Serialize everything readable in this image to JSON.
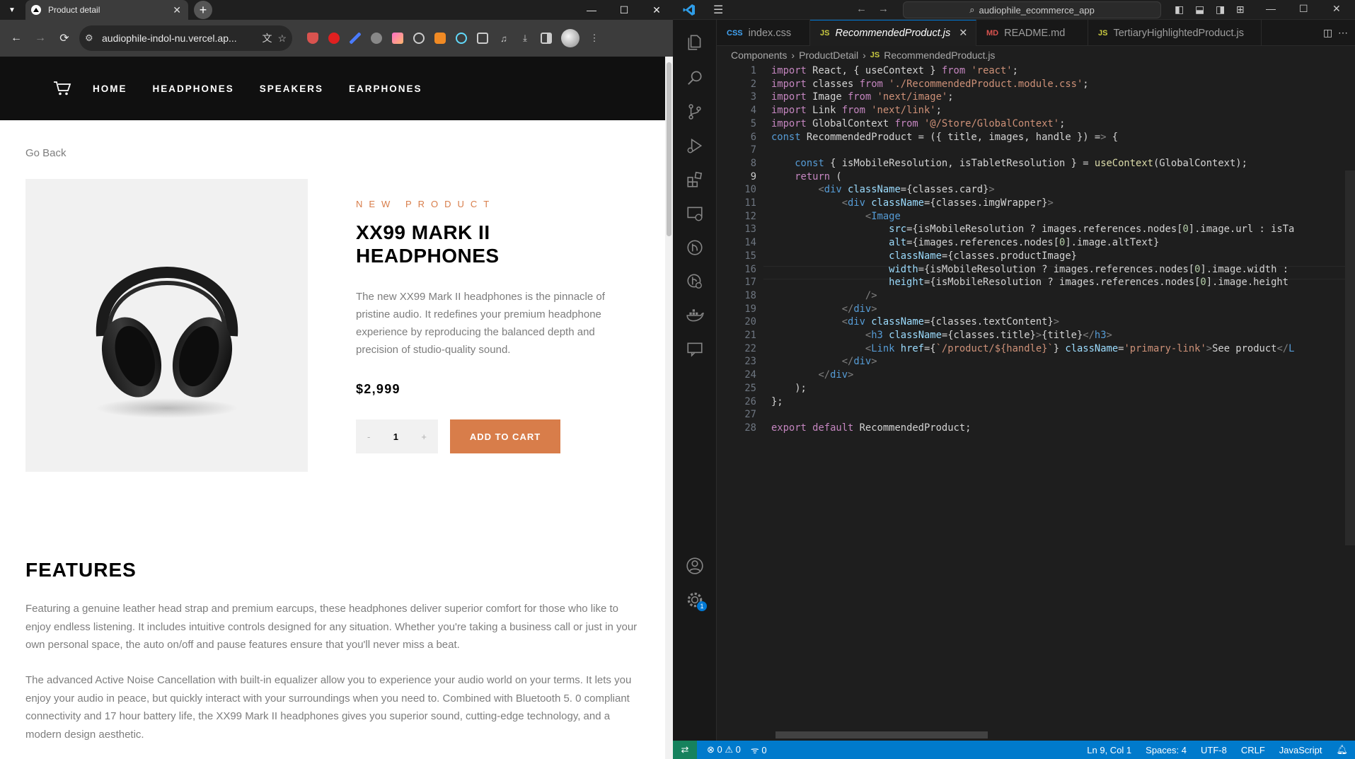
{
  "browser": {
    "tab_title": "Product detail",
    "url": "audiophile-indol-nu.vercel.ap...",
    "site": {
      "nav": [
        "HOME",
        "HEADPHONES",
        "SPEAKERS",
        "EARPHONES"
      ],
      "go_back": "Go Back",
      "overline": "NEW PRODUCT",
      "title": "XX99 MARK II HEADPHONES",
      "description": "The new XX99 Mark II headphones is the pinnacle of pristine audio. It redefines your premium headphone experience by reproducing the balanced depth and precision of studio-quality sound.",
      "price": "$2,999",
      "quantity": "1",
      "qty_minus": "-",
      "qty_plus": "+",
      "add_to_cart": "ADD TO CART",
      "features_heading": "FEATURES",
      "features_p1": "Featuring a genuine leather head strap and premium earcups, these headphones deliver superior comfort for those who like to enjoy endless listening. It includes intuitive controls designed for any situation. Whether you're taking a business call or just in your own personal space, the auto on/off and pause features ensure that you'll never miss a beat.",
      "features_p2": "The advanced Active Noise Cancellation with built-in equalizer allow you to experience your audio world on your terms. It lets you enjoy your audio in peace, but quickly interact with your surroundings when you need to. Combined with Bluetooth 5. 0 compliant connectivity and 17 hour battery life, the XX99 Mark II headphones gives you superior sound, cutting-edge technology, and a modern design aesthetic.",
      "accent_color": "#d87d4a"
    }
  },
  "vscode": {
    "search": "audiophile_ecommerce_app",
    "tabs": [
      {
        "label": "index.css",
        "icon": "css-file-icon",
        "icon_text": "CSS"
      },
      {
        "label": "RecommendedProduct.js",
        "icon": "js-file-icon",
        "icon_text": "JS",
        "active": true
      },
      {
        "label": "README.md",
        "icon": "markdown-file-icon",
        "icon_text": "MD"
      },
      {
        "label": "TertiaryHighlightedProduct.js",
        "icon": "js-file-icon",
        "icon_text": "JS"
      }
    ],
    "breadcrumb": [
      "Components",
      "ProductDetail",
      "RecommendedProduct.js"
    ],
    "breadcrumb_js": "JS",
    "current_line": 9,
    "code_lines": [
      "import React, { useContext } from 'react';",
      "import classes from './RecommendedProduct.module.css';",
      "import Image from 'next/image';",
      "import Link from 'next/link';",
      "import GlobalContext from '@/Store/GlobalContext';",
      "const RecommendedProduct = ({ title, images, handle }) => {",
      "",
      "    const { isMobileResolution, isTabletResolution } = useContext(GlobalContext);",
      "    return (",
      "        <div className={classes.card}>",
      "            <div className={classes.imgWrapper}>",
      "                <Image",
      "                    src={isMobileResolution ? images.references.nodes[0].image.url : isTa",
      "                    alt={images.references.nodes[0].image.altText}",
      "                    className={classes.productImage}",
      "                    width={isMobileResolution ? images.references.nodes[0].image.width :",
      "                    height={isMobileResolution ? images.references.nodes[0].image.height",
      "                />",
      "            </div>",
      "            <div className={classes.textContent}>",
      "                <h3 className={classes.title}>{title}</h3>",
      "                <Link href={`/product/${handle}`} className='primary-link'>See product</L",
      "            </div>",
      "        </div>",
      "    );",
      "};",
      "",
      "export default RecommendedProduct;"
    ],
    "status": {
      "errors": "0",
      "warnings": "0",
      "ports": "0",
      "position": "Ln 9, Col 1",
      "spaces": "Spaces: 4",
      "encoding": "UTF-8",
      "eol": "CRLF",
      "language": "JavaScript"
    },
    "settings_badge": "1"
  }
}
